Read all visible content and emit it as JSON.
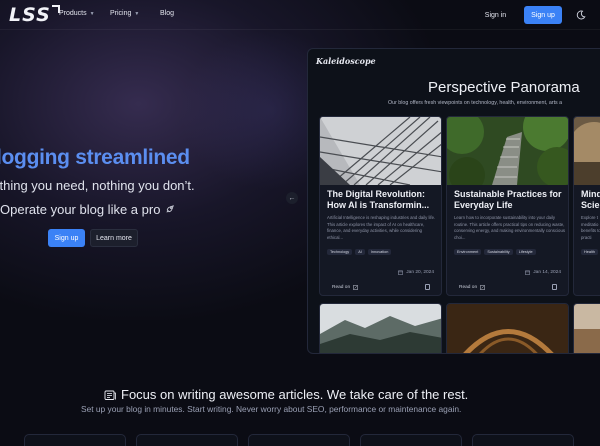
{
  "nav": {
    "logo": "LSS",
    "products": "Products",
    "pricing": "Pricing",
    "blog": "Blog",
    "sign_in": "Sign in",
    "sign_up": "Sign up",
    "theme_icon": "moon-icon"
  },
  "hero": {
    "title": "logging streamlined",
    "subtitle": "ything you need, nothing you don’t.",
    "tagline": "Operate your blog like a pro",
    "tagline_icon": "rocket-icon",
    "sign_up": "Sign up",
    "learn_more": "Learn more",
    "accent": "#5b8ef0"
  },
  "preview": {
    "brand": "Kaleidoscope",
    "title": "Perspective Panorama",
    "description": "Our blog offers fresh viewpoints on technology, health, environment, arts a",
    "cards": [
      {
        "title": "The Digital Revolution: How AI is Transformin...",
        "text": "Artificial Intelligence is reshaping industries and daily life. This article explores the impact of AI on healthcare, finance, and everyday activities, while considering ethical...",
        "tags": [
          "Technology",
          "AI",
          "Innovation"
        ],
        "date": "Jan 20, 2024",
        "read_on": "Read on"
      },
      {
        "title": "Sustainable Practices for Everyday Life",
        "text": "Learn how to incorporate sustainability into your daily routine. This article offers practical tips on reducing waste, conserving energy, and making environmentally conscious choi...",
        "tags": [
          "Environment",
          "Sustainability",
          "Lifestyle"
        ],
        "date": "Jan 14, 2024",
        "read_on": "Read on"
      },
      {
        "title": "Mind Scie",
        "text": "Explore t meditatio benefits to practi",
        "tags": [
          "Health"
        ],
        "date": "",
        "read_on": ""
      }
    ]
  },
  "bottom": {
    "title": "Focus on writing awesome articles. We take care of the rest.",
    "subtitle": "Set up your blog in minutes. Start writing. Never worry about SEO, performance or maintenance again.",
    "title_icon": "newspaper-icon"
  }
}
